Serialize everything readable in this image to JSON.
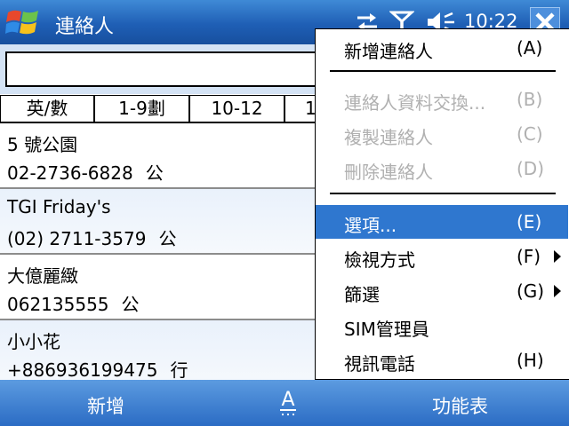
{
  "titlebar": {
    "title": "連絡人",
    "clock": "10:22",
    "icons": [
      "windows-logo",
      "sync-arrows",
      "signal-antenna",
      "speaker-volume",
      "close-x"
    ]
  },
  "search": {
    "value": "",
    "placeholder": ""
  },
  "tabs": [
    {
      "label": "英/數"
    },
    {
      "label": "1-9劃"
    },
    {
      "label": "10-12"
    },
    {
      "label": "1"
    }
  ],
  "contacts": [
    {
      "name": "5 號公園",
      "phone": "02-2736-6828",
      "type": "公"
    },
    {
      "name": "TGI Friday's",
      "phone": "(02) 2711-3579",
      "type": "公"
    },
    {
      "name": "大億麗緻",
      "phone": "062135555",
      "type": "公"
    },
    {
      "name": "小小花",
      "phone": "+886936199475",
      "type": "行"
    }
  ],
  "menu": {
    "items": [
      {
        "label": "新增連絡人",
        "accel": "(A)",
        "state": "enabled",
        "submenu": false
      },
      {
        "label": "連絡人資料交換...",
        "accel": "(B)",
        "state": "disabled",
        "submenu": false
      },
      {
        "label": "複製連絡人",
        "accel": "(C)",
        "state": "disabled",
        "submenu": false
      },
      {
        "label": "刪除連絡人",
        "accel": "(D)",
        "state": "disabled",
        "submenu": false
      },
      {
        "label": "選項...",
        "accel": "(E)",
        "state": "selected",
        "submenu": false
      },
      {
        "label": "檢視方式",
        "accel": "(F)",
        "state": "enabled",
        "submenu": true
      },
      {
        "label": "篩選",
        "accel": "(G)",
        "state": "enabled",
        "submenu": true
      },
      {
        "label": "SIM管理員",
        "accel": "",
        "state": "enabled",
        "submenu": false
      },
      {
        "label": "視訊電話",
        "accel": "(H)",
        "state": "enabled",
        "submenu": false
      }
    ]
  },
  "menubar": {
    "left_label": "新增",
    "input_label": "A",
    "right_label": "功能表"
  },
  "colors": {
    "titlebar": "#1f5fb5",
    "menubar": "#2b6cc4",
    "selection": "#2f77cf",
    "disabled_text": "#b0b0b0",
    "search_band": "#d4e3f5"
  }
}
